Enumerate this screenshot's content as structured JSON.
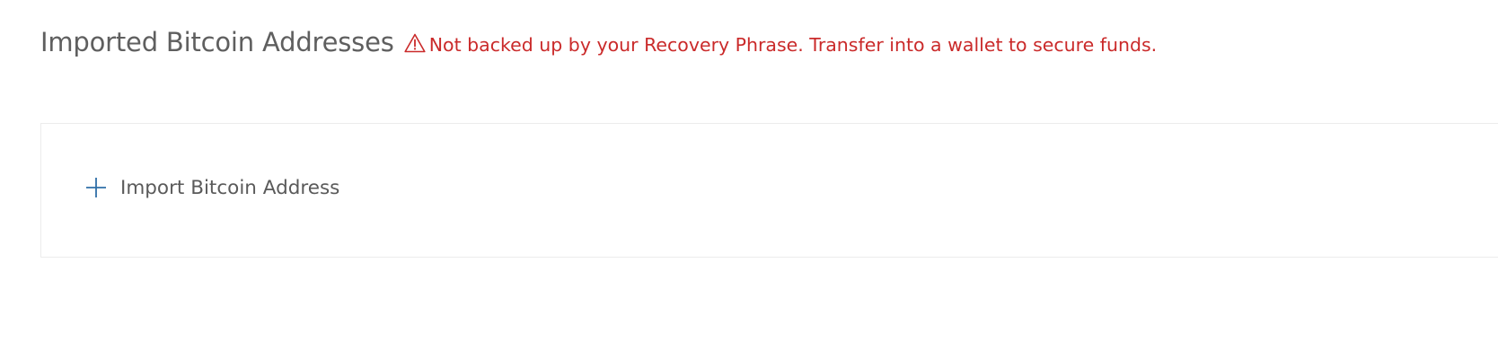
{
  "section": {
    "title": "Imported Bitcoin Addresses",
    "warning_icon": "warning-triangle-icon",
    "warning_text": "Not backed up by your Recovery Phrase. Transfer into a wallet to secure funds.",
    "warning_color": "#ca2a2a"
  },
  "panel": {
    "import_icon": "plus-icon",
    "import_label": "Import Bitcoin Address",
    "accent_color": "#2f6fa8"
  }
}
